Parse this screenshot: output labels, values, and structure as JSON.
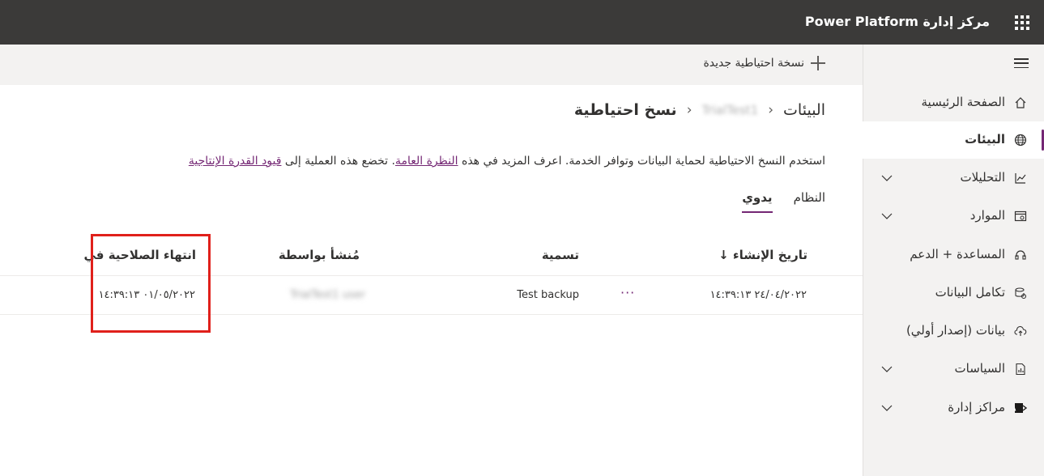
{
  "topbar": {
    "title": "مركز إدارة Power Platform",
    "waffle_icon": "app-launcher-icon"
  },
  "nav": {
    "items": [
      {
        "label": "الصفحة الرئيسية",
        "icon": "home-icon",
        "expandable": false,
        "active": false
      },
      {
        "label": "البيئات",
        "icon": "globe-icon",
        "expandable": false,
        "active": true
      },
      {
        "label": "التحليلات",
        "icon": "chart-icon",
        "expandable": true,
        "active": false
      },
      {
        "label": "الموارد",
        "icon": "resources-icon",
        "expandable": true,
        "active": false
      },
      {
        "label": "المساعدة + الدعم",
        "icon": "headset-icon",
        "expandable": false,
        "active": false
      },
      {
        "label": "تكامل البيانات",
        "icon": "data-integration-icon",
        "expandable": false,
        "active": false
      },
      {
        "label": "بيانات (إصدار أولي)",
        "icon": "cloud-upload-icon",
        "expandable": false,
        "active": false
      },
      {
        "label": "السياسات",
        "icon": "policies-icon",
        "expandable": true,
        "active": false
      },
      {
        "label": "مراكز إدارة",
        "icon": "admin-centers-icon",
        "expandable": true,
        "active": false
      }
    ]
  },
  "commandbar": {
    "new_backup_label": "نسخة احتياطية جديدة"
  },
  "breadcrumb": {
    "environments": "البيئات",
    "environment_name": "TrialTest1",
    "current": "نسخ احتياطية"
  },
  "description": {
    "text_1": "استخدم النسخ الاحتياطية لحماية البيانات وتوافر الخدمة. اعرف المزيد في هذه ",
    "link_1": "النظرة العامة",
    "text_2": ". تخضع هذه العملية إلى ",
    "link_2": "قيود القدرة الإنتاجية"
  },
  "tabs": {
    "system": "النظام",
    "manual": "يدوي"
  },
  "table": {
    "headers": {
      "created_on": "تاريخ الإنشاء ↓",
      "label": "تسمية",
      "created_by": "مُنشأ بواسطة",
      "expires_on": "انتهاء الصلاحية في"
    },
    "rows": [
      {
        "created_on": "٢٤/٠٤/٢٠٢٢ ١٤:٣٩:١٣",
        "more": "···",
        "label": "Test backup",
        "created_by": "TrialTest1 user",
        "expires_on": "٠١/٠٥/٢٠٢٢ ١٤:٣٩:١٣"
      }
    ]
  },
  "colors": {
    "accent": "#742774",
    "topbar": "#3b3a39",
    "highlight": "#e0201b"
  }
}
